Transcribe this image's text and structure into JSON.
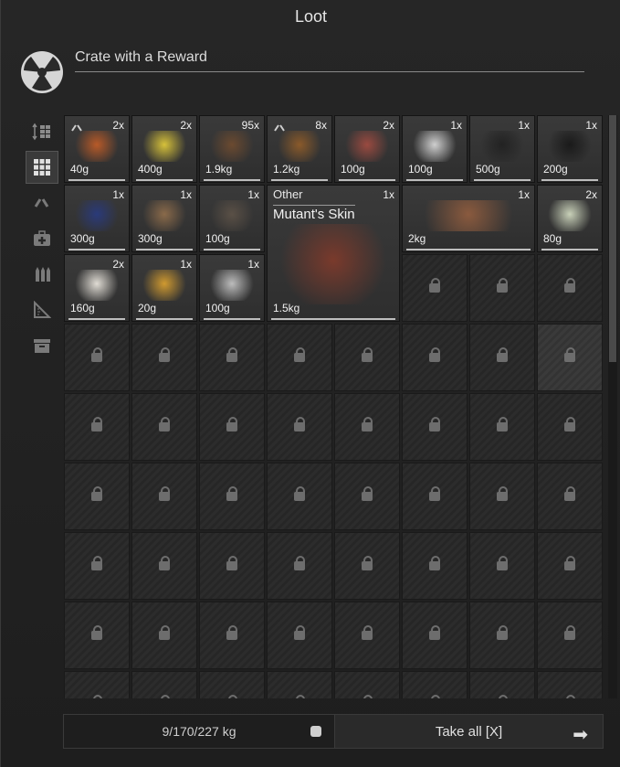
{
  "window": {
    "title": "Loot"
  },
  "crate": {
    "name": "Crate with a Reward",
    "logo_icon": "radiation-icon"
  },
  "sidebar": {
    "items": [
      {
        "icon": "sort-icon",
        "active": false
      },
      {
        "icon": "grid-icon",
        "active": true
      },
      {
        "icon": "link-icon",
        "active": false
      },
      {
        "icon": "medkit-icon",
        "active": false
      },
      {
        "icon": "ammo-icon",
        "active": false
      },
      {
        "icon": "ruler-icon",
        "active": false
      },
      {
        "icon": "archive-icon",
        "active": false
      }
    ]
  },
  "items": [
    {
      "name": "cigarette",
      "qty": "2x",
      "weight": "40g",
      "linked": true,
      "color": "#b85a28"
    },
    {
      "name": "first-aid-kit",
      "qty": "2x",
      "weight": "400g",
      "color": "#d6c13a"
    },
    {
      "name": "ammo-pack",
      "qty": "95x",
      "weight": "1.9kg",
      "color": "#6b4a30"
    },
    {
      "name": "device",
      "qty": "8x",
      "weight": "1.2kg",
      "linked": true,
      "color": "#8a5a2a"
    },
    {
      "name": "heat-pad",
      "qty": "2x",
      "weight": "100g",
      "color": "#9a4a40"
    },
    {
      "name": "transistor",
      "qty": "1x",
      "weight": "100g",
      "color": "#cfcfcf"
    },
    {
      "name": "knife-sharpener",
      "qty": "1x",
      "weight": "500g",
      "color": "#222222"
    },
    {
      "name": "capacitor",
      "qty": "1x",
      "weight": "200g",
      "color": "#1a1a1a"
    },
    {
      "name": "book",
      "qty": "1x",
      "weight": "300g",
      "color": "#2a3a7a"
    },
    {
      "name": "radio-box",
      "qty": "1x",
      "weight": "300g",
      "color": "#8a6a4a"
    },
    {
      "name": "claw",
      "qty": "1x",
      "weight": "100g",
      "color": "#5a5046"
    },
    {
      "name": "mutant-skin",
      "qty": "1x",
      "weight": "1.5kg",
      "category": "Other",
      "title": "Mutant's Skin",
      "color": "#7a3a2c"
    },
    {
      "name": "bone",
      "qty": "1x",
      "weight": "2kg",
      "color": "#8a5a3e"
    },
    {
      "name": "money",
      "qty": "2x",
      "weight": "80g",
      "color": "#c8d0b8"
    },
    {
      "name": "paper-roll",
      "qty": "2x",
      "weight": "160g",
      "color": "#e0dcd4"
    },
    {
      "name": "lighter",
      "qty": "1x",
      "weight": "20g",
      "color": "#d09a30"
    },
    {
      "name": "flask",
      "qty": "1x",
      "weight": "100g",
      "color": "#bcbcbc"
    }
  ],
  "footer": {
    "weight": "9/170/227 kg",
    "weight_icon": "kettlebell-icon",
    "take_all": "Take all [X]",
    "arrow_icon": "arrow-right-icon"
  }
}
